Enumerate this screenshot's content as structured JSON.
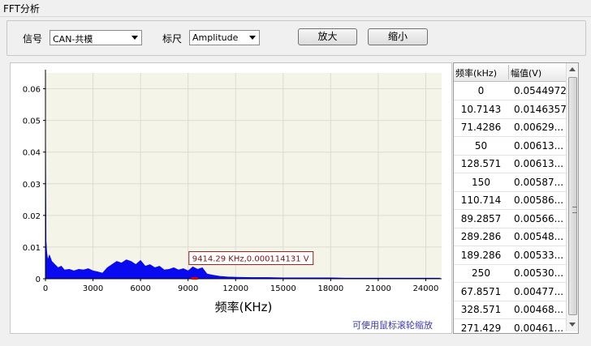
{
  "window": {
    "title": "FFT分析"
  },
  "toolbar": {
    "signal_label": "信号",
    "signal_value": "CAN-共模",
    "scale_label": "标尺",
    "scale_value": "Amplitude",
    "zoom_in_label": "放大",
    "zoom_out_label": "缩小"
  },
  "chart_data": {
    "type": "area",
    "xlabel": "频率(KHz)",
    "ylabel": "",
    "xlim": [
      0,
      25000
    ],
    "ylim": [
      0,
      0.065
    ],
    "x_ticks": [
      0,
      3000,
      6000,
      9000,
      12000,
      15000,
      18000,
      21000,
      24000
    ],
    "y_ticks": [
      0,
      0.01,
      0.02,
      0.03,
      0.04,
      0.05,
      0.06
    ],
    "y_tick_labels": [
      "0",
      "0.01",
      "0.02",
      "0.03",
      "0.04",
      "0.05",
      "0.06"
    ],
    "background": "#f4f4e9",
    "fill_color": "#0a0af0",
    "grid": true,
    "series": [
      {
        "x": [
          0,
          40,
          80,
          150,
          250,
          400,
          600,
          800,
          1000,
          1200,
          1500,
          1800,
          2100,
          2400,
          2700,
          3000,
          3300,
          3600,
          3900,
          4200,
          4500,
          4800,
          5100,
          5400,
          5700,
          6000,
          6300,
          6600,
          6900,
          7200,
          7500,
          7800,
          8100,
          8400,
          8700,
          9000,
          9300,
          9600,
          9900,
          10200,
          10500,
          11000,
          11500,
          12000,
          13000,
          14000,
          15000,
          16000,
          17000,
          18000,
          19000,
          20000,
          21000,
          22000,
          23000,
          24000,
          24900
        ],
        "y": [
          0.0545,
          0.012,
          0.0085,
          0.006,
          0.0075,
          0.0055,
          0.0045,
          0.0035,
          0.004,
          0.0028,
          0.003,
          0.0025,
          0.003,
          0.0028,
          0.0032,
          0.0025,
          0.0022,
          0.0018,
          0.0035,
          0.0045,
          0.0055,
          0.005,
          0.006,
          0.0055,
          0.0045,
          0.0058,
          0.004,
          0.0045,
          0.0035,
          0.004,
          0.0028,
          0.003,
          0.0035,
          0.0028,
          0.0032,
          0.0025,
          0.0038,
          0.003,
          0.0035,
          0.0015,
          0.0012,
          0.0008,
          0.0006,
          0.0005,
          0.0004,
          0.0004,
          0.0003,
          0.0003,
          0.0003,
          0.0003,
          0.0002,
          0.0002,
          0.0002,
          0.0002,
          0.0002,
          0.0002,
          0.0002
        ]
      }
    ],
    "marker": {
      "x": 9414.29,
      "y": 0.000114131,
      "label": "9414.29 KHz,0.000114131 V"
    }
  },
  "hint": "可使用鼠标滚轮缩放",
  "table": {
    "headers": [
      "频率(kHz)",
      "幅值(V)"
    ],
    "rows": [
      [
        "0",
        "0.0544972"
      ],
      [
        "10.7143",
        "0.0146357"
      ],
      [
        "71.4286",
        "0.00629..."
      ],
      [
        "50",
        "0.00613..."
      ],
      [
        "128.571",
        "0.00613..."
      ],
      [
        "150",
        "0.00587..."
      ],
      [
        "110.714",
        "0.00586..."
      ],
      [
        "89.2857",
        "0.00566..."
      ],
      [
        "289.286",
        "0.00548..."
      ],
      [
        "189.286",
        "0.00533..."
      ],
      [
        "250",
        "0.00530..."
      ],
      [
        "67.8571",
        "0.00477..."
      ],
      [
        "328.571",
        "0.00468..."
      ],
      [
        "271.429",
        "0.00461..."
      ]
    ]
  }
}
